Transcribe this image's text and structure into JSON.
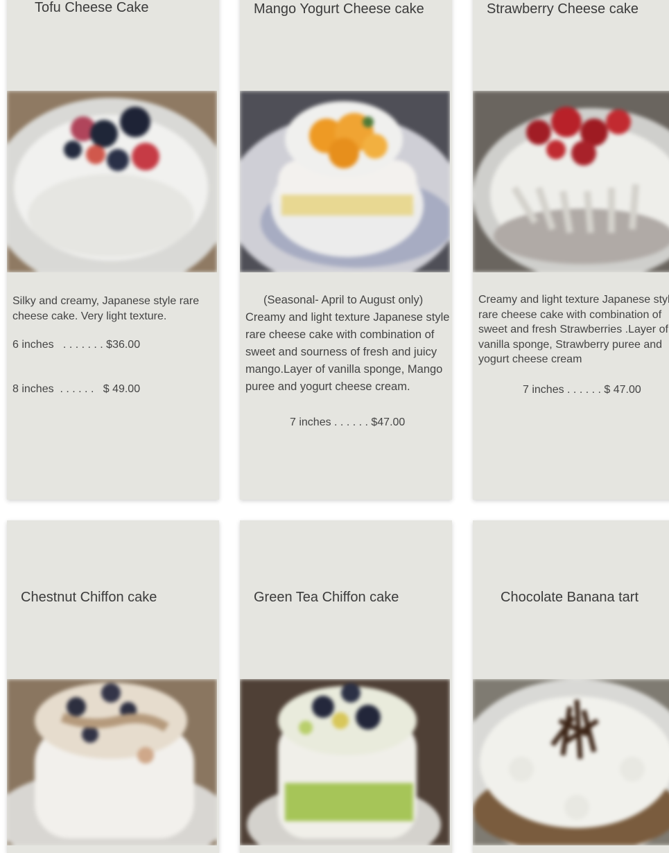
{
  "row1": [
    {
      "title": "Tofu Cheese Cake",
      "description": "Silky and creamy, Japanese style rare cheese cake. Very light texture.",
      "prices": [
        "6 inches   . . . . . . . $36.00",
        "8 inches  . . . . . .   $ 49.00"
      ],
      "photo": "tofu-cheesecake-photo"
    },
    {
      "title": "Mango Yogurt Cheese cake",
      "season_note": "(Seasonal- April to August only)",
      "description": "Creamy and light texture Japanese style rare cheese cake with combination of sweet and sourness of fresh and juicy mango.Layer of vanilla sponge, Mango puree and yogurt cheese cream.",
      "prices": [
        "7 inches . . . . . . $47.00"
      ],
      "photo": "mango-cheesecake-photo"
    },
    {
      "title": "Strawberry Cheese cake",
      "description": "Creamy and light texture Japanese style rare cheese cake with combination of sweet and fresh Strawberries .Layer of vanilla sponge, Strawberry puree and yogurt cheese cream",
      "prices": [
        "7 inches . . . . . . $ 47.00"
      ],
      "photo": "strawberry-cheesecake-photo"
    }
  ],
  "row2": [
    {
      "title": "Chestnut Chiffon cake",
      "photo": "chestnut-chiffon-photo"
    },
    {
      "title": "Green Tea Chiffon cake",
      "photo": "green-tea-chiffon-photo"
    },
    {
      "title": "Chocolate Banana tart",
      "photo": "chocolate-banana-tart-photo"
    }
  ],
  "colors": {
    "card_background": "#e5e5e0",
    "text": "#3b3b3b"
  }
}
